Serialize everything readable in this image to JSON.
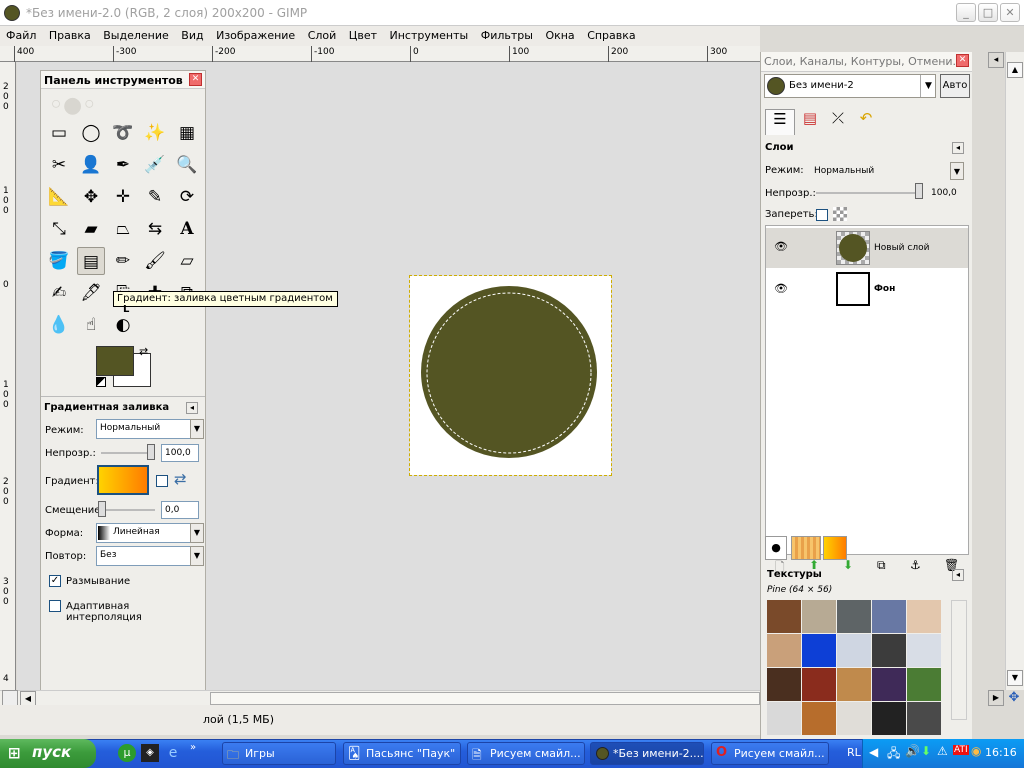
{
  "window": {
    "title": "*Без имени-2.0 (RGB, 2 слоя) 200x200 - GIMP",
    "buttons": {
      "minimize": "_",
      "maximize": "□",
      "close": "✕"
    }
  },
  "menubar": [
    "Файл",
    "Правка",
    "Выделение",
    "Вид",
    "Изображение",
    "Слой",
    "Цвет",
    "Инструменты",
    "Фильтры",
    "Окна",
    "Справка"
  ],
  "ruler": {
    "h_labels": [
      "400",
      "-300",
      "-200",
      "-100",
      "0",
      "100",
      "200",
      "300"
    ],
    "v_labels": [
      "2",
      "0",
      "0",
      "1",
      "0",
      "0",
      "0",
      "1",
      "0",
      "0",
      "2",
      "0",
      "0",
      "3",
      "0",
      "0",
      "4"
    ]
  },
  "toolbox": {
    "title": "Панель инструментов",
    "tooltip": "Градиент: заливка цветным градиентом",
    "tooltip_key": "L",
    "fg_color": "#545523",
    "bg_color": "#ffffff",
    "options": {
      "title": "Градиентная заливка",
      "mode_label": "Режим:",
      "mode_value": "Нормальный",
      "opacity_label": "Непрозр.:",
      "opacity_value": "100,0",
      "gradient_label": "Градиент:",
      "offset_label": "Смещение:",
      "offset_value": "0,0",
      "shape_label": "Форма:",
      "shape_value": "Линейная",
      "repeat_label": "Повтор:",
      "repeat_value": "Без",
      "dither_label": "Размывание",
      "dither_checked": true,
      "adaptive_label": "Адаптивная интерполяция",
      "adaptive_checked": false
    }
  },
  "canvas": {
    "fill_color": "#545523"
  },
  "dock": {
    "title": "Слои, Каналы, Контуры, Отмени...",
    "image_select": "Без имени-2",
    "auto_button": "Авто",
    "layers": {
      "title": "Слои",
      "mode_label": "Режим:",
      "mode_value": "Нормальный",
      "opacity_label": "Непрозр.:",
      "opacity_value": "100,0",
      "lock_label": "Запереть:",
      "items": [
        {
          "name": "Новый слой",
          "bold": false,
          "selected": true
        },
        {
          "name": "Фон",
          "bold": true,
          "selected": false
        }
      ]
    },
    "textures": {
      "title": "Текстуры",
      "current": "Pine (64 × 56)"
    }
  },
  "status": {
    "text": "лой (1,5 МБ)"
  },
  "taskbar": {
    "start": "пуск",
    "tasks": [
      "Игры",
      "Пасьянс \"Паук\"",
      "Рисуем смайл...",
      "*Без имени-2....",
      "Рисуем смайл..."
    ],
    "tray_lang": "RL",
    "clock": "16:16"
  }
}
